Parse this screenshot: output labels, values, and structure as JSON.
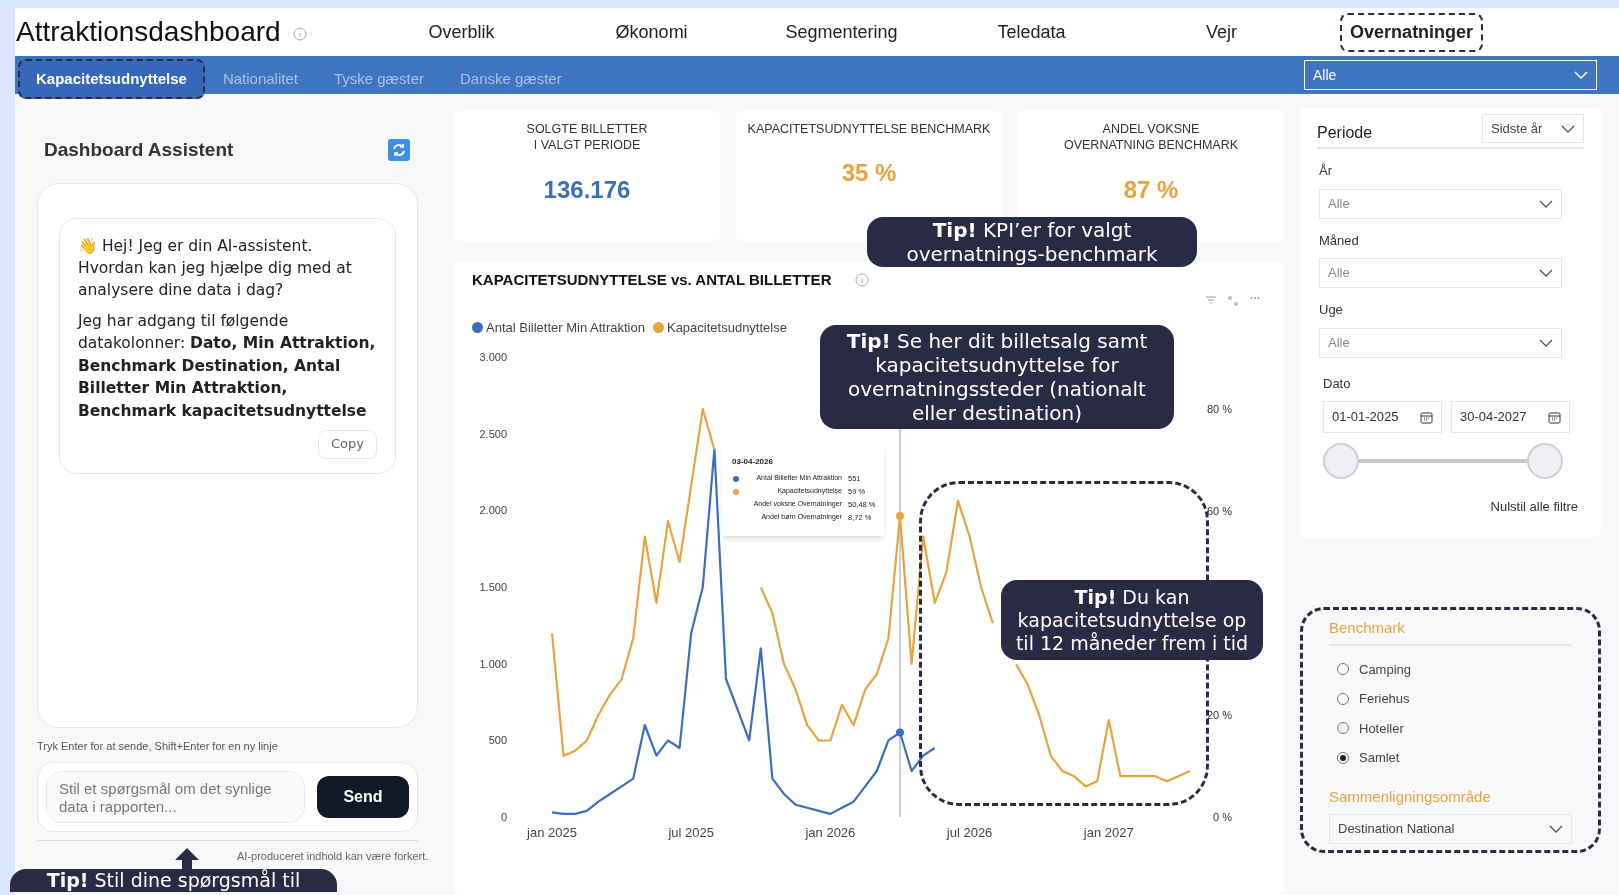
{
  "header": {
    "title": "Attraktionsdashboard",
    "nav": [
      {
        "label": "Overblik",
        "selected": false
      },
      {
        "label": "Økonomi",
        "selected": false
      },
      {
        "label": "Segmentering",
        "selected": false
      },
      {
        "label": "Teledata",
        "selected": false
      },
      {
        "label": "Vejr",
        "selected": false
      },
      {
        "label": "Overnatninger",
        "selected": true
      }
    ]
  },
  "subnav": {
    "tabs": [
      {
        "label": "Kapacitetsudnyttelse",
        "selected": true
      },
      {
        "label": "Nationalitet",
        "selected": false
      },
      {
        "label": "Tyske gæster",
        "selected": false
      },
      {
        "label": "Danske gæster",
        "selected": false
      }
    ],
    "dropdown": "Alle"
  },
  "assistant": {
    "title": "Dashboard Assistent",
    "message": {
      "paragraphs": [
        "👋 Hej! Jeg er din AI-assistent. Hvordan kan jeg hjælpe dig med at analysere dine data i dag?",
        "Jeg har adgang til følgende datakolonner: **Dato, Min Attraktion, Benchmark Destination, Antal Billetter Min Attraktion, Benchmark kapacitetsudnyttelse**"
      ],
      "copy": "Copy"
    },
    "hint": "Tryk Enter for at sende, Shift+Enter for en ny linje",
    "placeholder": "Stil et spørgsmål om det synlige data i rapporten...",
    "send": "Send",
    "notice": "AI-produceret indhold kan være forkert."
  },
  "kpis": [
    {
      "title": "SOLGTE BILLETTER\nI VALGT PERIODE",
      "value": "136.176",
      "color": "#3b6fbd"
    },
    {
      "title": "KAPACITETSUDNYTTELSE BENCHMARK",
      "value": "35 %",
      "color": "#e8a33d"
    },
    {
      "title": "ANDEL VOKSNE\nOVERNATNING BENCHMARK",
      "value": "87 %",
      "color": "#e8a33d"
    }
  ],
  "chart": {
    "title": "KAPACITETSUDNYTTELSE vs. ANTAL BILLETTER",
    "tooltip": {
      "date": "03-04-2026",
      "rows": [
        {
          "label": "Antal Billetter Min Attraktion",
          "value": "551",
          "color": "#3b6fbd"
        },
        {
          "label": "Kapacitetsudnyttelse",
          "value": "59 %",
          "color": "#e8a33d"
        },
        {
          "label": "Andel voksne Overnatninger",
          "value": "50,48 %"
        },
        {
          "label": "Andel børn Overnatninger",
          "value": "8,72 %"
        }
      ]
    },
    "chart_data": {
      "type": "line",
      "categories": [
        "jan 2025",
        null,
        null,
        null,
        null,
        null,
        null,
        null,
        null,
        null,
        null,
        null,
        "jul 2025",
        null,
        null,
        null,
        null,
        null,
        null,
        null,
        null,
        null,
        null,
        null,
        "jan 2026",
        null,
        null,
        null,
        null,
        null,
        null,
        null,
        null,
        null,
        null,
        null,
        "jul 2026",
        null,
        null,
        null,
        null,
        null,
        null,
        null,
        null,
        null,
        null,
        null,
        "jan 2027",
        null,
        null,
        null,
        null,
        null,
        null,
        null
      ],
      "series": [
        {
          "name": "Antal Billetter Min Attraktion",
          "color": "#3b6fbd",
          "values": [
            30,
            20,
            20,
            40,
            100,
            150,
            200,
            250,
            600,
            400,
            500,
            450,
            1200,
            1500,
            2400,
            900,
            700,
            500,
            1100,
            250,
            150,
            80,
            60,
            40,
            20,
            60,
            100,
            200,
            300,
            500,
            551,
            300,
            400,
            450,
            null,
            null,
            null,
            null,
            null,
            null,
            null,
            null,
            null,
            null,
            null,
            null,
            null,
            null,
            null,
            null,
            null,
            null,
            null,
            null,
            null,
            null
          ]
        },
        {
          "name": "Kapacitetsudnyttelse",
          "color": "#e8a33d",
          "axis": "y2",
          "values": [
            36,
            12,
            13,
            15,
            20,
            24,
            27,
            35,
            55,
            42,
            58,
            50,
            65,
            80,
            72,
            null,
            null,
            null,
            45,
            40,
            30,
            25,
            18,
            15,
            15,
            22,
            18,
            25,
            28,
            35,
            59,
            30,
            55,
            42,
            48,
            62,
            55,
            45,
            38,
            null,
            30,
            26,
            20,
            12,
            9,
            8,
            6,
            7,
            19,
            8,
            8,
            8,
            8,
            7,
            8,
            9
          ]
        }
      ],
      "ylim": [
        0,
        3000
      ],
      "yticks": [
        {
          "value": 0,
          "label": "0"
        },
        {
          "value": 500,
          "label": "500"
        },
        {
          "value": 1000,
          "label": "1.000"
        },
        {
          "value": 1500,
          "label": "1.500"
        },
        {
          "value": 2000,
          "label": "2.000"
        },
        {
          "value": 2500,
          "label": "2.500"
        },
        {
          "value": 3000,
          "label": "3.000"
        }
      ],
      "y2lim": [
        0,
        80
      ],
      "y2ticks": [
        {
          "value": 0,
          "label": "0 %"
        },
        {
          "value": 20,
          "label": "20 %"
        },
        {
          "value": 60,
          "label": "60 %"
        },
        {
          "value": 80,
          "label": "80 %"
        }
      ]
    }
  },
  "filters": {
    "period": {
      "label": "Periode",
      "value": "Sidste år"
    },
    "dropdowns": [
      {
        "label": "År",
        "value": "Alle"
      },
      {
        "label": "Måned",
        "value": "Alle"
      },
      {
        "label": "Uge",
        "value": "Alle"
      }
    ],
    "date": {
      "label": "Dato",
      "from": "01-01-2025",
      "to": "30-04-2027",
      "level": 1
    },
    "reset": "Nulstil alle filtre",
    "benchmark": {
      "title": "Benchmark",
      "options": [
        {
          "label": "Camping",
          "selected": false
        },
        {
          "label": "Feriehus",
          "selected": false
        },
        {
          "label": "Hoteller",
          "selected": false
        },
        {
          "label": "Samlet",
          "selected": true
        }
      ],
      "area_label": "Sammenligningsområde",
      "area_value": "Destination National"
    }
  },
  "tips": [
    {
      "text": "**Tip!** KPI’er for valgt overnatnings-benchmark"
    },
    {
      "text": "**Tip!** Se her dit billetsalg samt kapacitetsudnyttelse for overnatningssteder (nationalt eller destination)"
    },
    {
      "text": "**Tip!** Du kan kapacitetsudnyttelse op til 12 måneder frem i tid"
    },
    {
      "text": "**Tip!** Stil dine spørgsmål til"
    }
  ]
}
